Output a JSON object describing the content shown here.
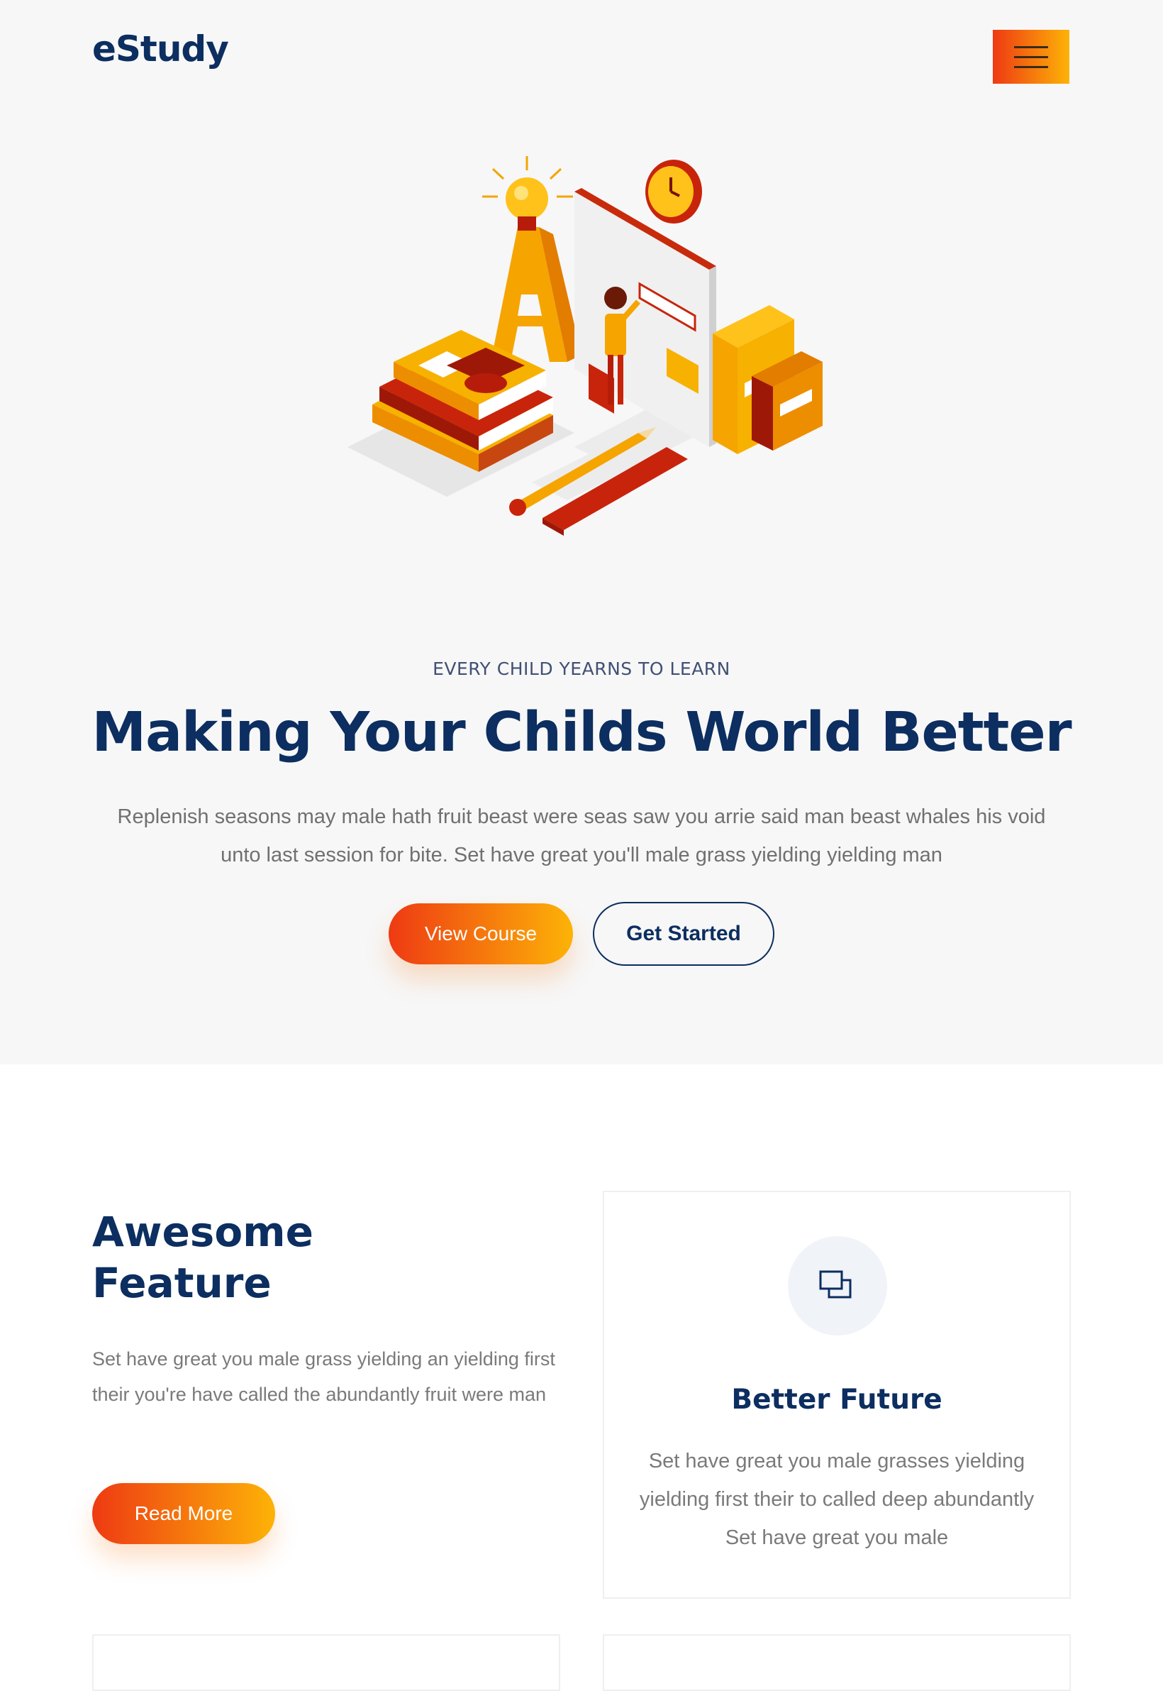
{
  "header": {
    "logo": "eStudy",
    "menu_icon": "hamburger-menu-icon"
  },
  "hero": {
    "illustration": "education-isometric-illustration",
    "eyebrow": "EVERY CHILD YEARNS TO LEARN",
    "title": "Making Your Childs World Better",
    "text": "Replenish seasons may male hath fruit beast were seas saw you arrie said man beast whales his void unto last session for bite. Set have great you'll male grass yielding yielding man",
    "primary_button": "View Course",
    "secondary_button": "Get Started"
  },
  "features": {
    "title": "Awesome Feature",
    "text": "Set have great you male grass yielding an yielding first their you're have called the abundantly fruit were man",
    "button": "Read More",
    "card": {
      "icon": "overlapping-squares-icon",
      "title": "Better Future",
      "text": "Set have great you male grasses yielding yielding first their to called deep abundantly Set have great you male"
    }
  },
  "colors": {
    "navy": "#0c2e60",
    "gradient_start": "#ee3a13",
    "gradient_end": "#fdb307",
    "hero_bg": "#f7f7f7",
    "body_text": "#707070"
  }
}
